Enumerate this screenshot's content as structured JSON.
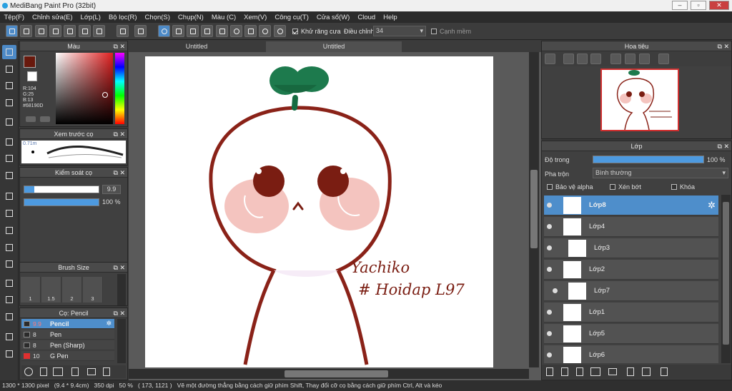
{
  "window": {
    "title": "MediBang Paint Pro (32bit)"
  },
  "menu": [
    "Tệp(F)",
    "Chỉnh sửa(E)",
    "Lớp(L)",
    "Bộ lọc(R)",
    "Chọn(S)",
    "Chụp(N)",
    "Màu (C)",
    "Xem(V)",
    "Công cụ(T)",
    "Cửa sổ(W)",
    "Cloud",
    "Help"
  ],
  "toolbar": {
    "antialias_label": "Khử răng cưa",
    "antialias_checked": true,
    "correction_label": "Điều chỉnh",
    "correction_value": "34",
    "smooth_label": "Cạnh mềm",
    "smooth_checked": false
  },
  "color_panel": {
    "title": "Màu",
    "r": "R:104",
    "g": "G:25",
    "b": "B:13",
    "hex": "#68190D",
    "primary": "#68190D",
    "secondary": "#ffffff"
  },
  "brush_preview": {
    "title": "Xem trước cọ",
    "size": "0.71m"
  },
  "brush_control": {
    "title": "Kiểm soát cọ",
    "size_value": "9.9",
    "opacity_value": "100 %",
    "size_level": 0.13,
    "opacity_level": 1.0
  },
  "brush_size": {
    "title": "Brush Size",
    "sizes": [
      "1",
      "1.5",
      "2",
      "3"
    ]
  },
  "brush_list": {
    "title": "Cọ: Pencil",
    "items": [
      {
        "size": "9.9",
        "name": "Pencil",
        "color": "#2b2b2b",
        "selected": true
      },
      {
        "size": "8",
        "name": "Pen",
        "color": "#2b2b2b",
        "selected": false
      },
      {
        "size": "8",
        "name": "Pen (Sharp)",
        "color": "#2b2b2b",
        "selected": false
      },
      {
        "size": "10",
        "name": "G Pen",
        "color": "#e03030",
        "selected": false
      }
    ]
  },
  "document": {
    "tabs": [
      "Untitled",
      "Untitled"
    ],
    "active_tab": 1
  },
  "artwork": {
    "signature_line1": "Yachiko",
    "signature_line2": "# Hoidap L97"
  },
  "navigator": {
    "title": "Hoa tiêu"
  },
  "layers": {
    "title": "Lớp",
    "opacity_label": "Độ trong",
    "opacity_value": "100 %",
    "opacity_level": 1.0,
    "blend_label": "Pha trộn",
    "blend_value": "Bình thường",
    "protect_alpha": "Bảo vệ alpha",
    "clipping": "Xén bớt",
    "lock": "Khóa",
    "items": [
      {
        "name": "Lớp8",
        "selected": true,
        "indent": false
      },
      {
        "name": "Lớp4",
        "selected": false,
        "indent": false
      },
      {
        "name": "Lớp3",
        "selected": false,
        "indent": true
      },
      {
        "name": "Lớp2",
        "selected": false,
        "indent": false
      },
      {
        "name": "Lớp7",
        "selected": false,
        "indent": true
      },
      {
        "name": "Lớp1",
        "selected": false,
        "indent": false
      },
      {
        "name": "Lớp5",
        "selected": false,
        "indent": false
      },
      {
        "name": "Lớp6",
        "selected": false,
        "indent": false
      }
    ]
  },
  "status": {
    "size": "1300 * 1300 pixel",
    "cm": "(9.4 * 9.4cm)",
    "dpi": "350 dpi",
    "zoom": "50 %",
    "coords": "( 173, 1121 )",
    "hint": "Vẽ một đường thẳng bằng cách giữ phím Shift, Thay đổi cỡ cọ bằng cách giữ phím Ctrl, Alt và kéo"
  }
}
